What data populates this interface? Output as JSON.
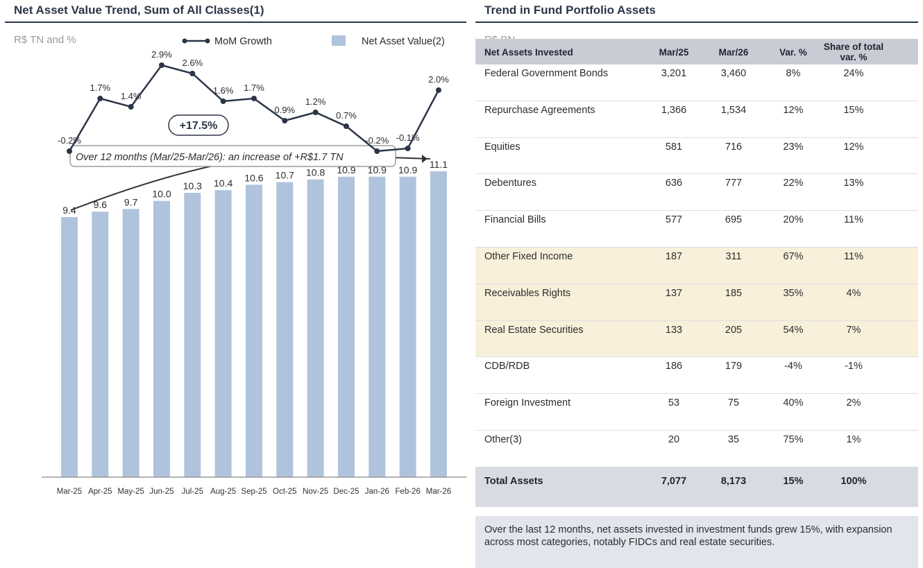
{
  "left_panel": {
    "title": "Net Asset Value Trend, Sum of All Classes(1)",
    "unit": "R$ TN and %"
  },
  "right_panel": {
    "title": "Trend in Fund Portfolio Assets",
    "unit": "R$ BN"
  },
  "chart_data": {
    "type": "bar",
    "categories": [
      "Mar-25",
      "Apr-25",
      "May-25",
      "Jun-25",
      "Jul-25",
      "Aug-25",
      "Sep-25",
      "Oct-25",
      "Nov-25",
      "Dec-25",
      "Jan-26",
      "Feb-26",
      "Mar-26"
    ],
    "series": [
      {
        "name": "Net Asset Value(2)",
        "type": "bar",
        "color": "#b0c3dc",
        "values": [
          9.4,
          9.6,
          9.7,
          10.0,
          10.3,
          10.4,
          10.6,
          10.7,
          10.8,
          10.9,
          10.9,
          10.9,
          11.1
        ],
        "labels": [
          "9.4",
          "9.6",
          "9.7",
          "10.0",
          "10.3",
          "10.4",
          "10.6",
          "10.7",
          "10.8",
          "10.9",
          "10.9",
          "10.9",
          "11.1"
        ]
      },
      {
        "name": "MoM Growth",
        "type": "line",
        "color": "#2b3547",
        "values": [
          -0.2,
          1.7,
          1.4,
          2.9,
          2.6,
          1.6,
          1.7,
          0.9,
          1.2,
          0.7,
          -0.2,
          -0.1,
          2.0
        ],
        "labels": [
          "-0.2%",
          "1.7%",
          "1.4%",
          "2.9%",
          "2.6%",
          "1.6%",
          "1.7%",
          "0.9%",
          "1.2%",
          "0.7%",
          "-0.2%",
          "-0.1%",
          "2.0%"
        ]
      }
    ],
    "bar_ylim": [
      0,
      11.1
    ],
    "line_ylim": [
      -0.2,
      2.9
    ],
    "legend": "top-right",
    "annotation_badge": "+17.5%",
    "annotation_text": "Over 12 months (Mar/25-Mar/26): an increase of +R$1.7 TN"
  },
  "table": {
    "headers": [
      "Net Assets Invested",
      "Mar/25",
      "Mar/26",
      "Var. %",
      "Share of total var. %"
    ],
    "rows": [
      {
        "name": "Federal Government Bonds",
        "mar25": "3,201",
        "mar26": "3,460",
        "var": "8%",
        "share": "24%",
        "highlight": false
      },
      {
        "name": "Repurchase Agreements",
        "mar25": "1,366",
        "mar26": "1,534",
        "var": "12%",
        "share": "15%",
        "highlight": false
      },
      {
        "name": "Equities",
        "mar25": "581",
        "mar26": "716",
        "var": "23%",
        "share": "12%",
        "highlight": false
      },
      {
        "name": "Debentures",
        "mar25": "636",
        "mar26": "777",
        "var": "22%",
        "share": "13%",
        "highlight": false
      },
      {
        "name": "Financial Bills",
        "mar25": "577",
        "mar26": "695",
        "var": "20%",
        "share": "11%",
        "highlight": false
      },
      {
        "name": "Other Fixed Income",
        "mar25": "187",
        "mar26": "311",
        "var": "67%",
        "share": "11%",
        "highlight": true
      },
      {
        "name": "Receivables Rights",
        "mar25": "137",
        "mar26": "185",
        "var": "35%",
        "share": "4%",
        "highlight": true
      },
      {
        "name": "Real Estate Securities",
        "mar25": "133",
        "mar26": "205",
        "var": "54%",
        "share": "7%",
        "highlight": true
      },
      {
        "name": "CDB/RDB",
        "mar25": "186",
        "mar26": "179",
        "var": "-4%",
        "share": "-1%",
        "highlight": false
      },
      {
        "name": "Foreign Investment",
        "mar25": "53",
        "mar26": "75",
        "var": "40%",
        "share": "2%",
        "highlight": false
      },
      {
        "name": "Other(3)",
        "mar25": "20",
        "mar26": "35",
        "var": "75%",
        "share": "1%",
        "highlight": false
      }
    ],
    "total": {
      "name": "Total Assets",
      "mar25": "7,077",
      "mar26": "8,173",
      "var": "15%",
      "share": "100%"
    }
  },
  "summary": "Over the last 12 months, net assets invested in investment funds grew 15%, with expansion across most categories, notably FIDCs and real estate securities."
}
